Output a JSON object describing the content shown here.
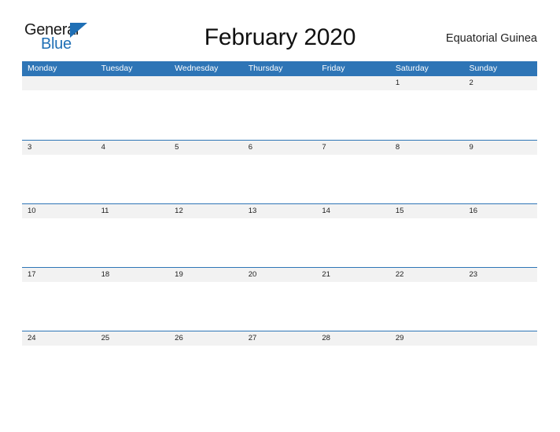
{
  "brand": {
    "name_part1": "General",
    "name_part2": "Blue",
    "flag_icon": "triangle-flag-icon",
    "accent_color": "#1f6fb5"
  },
  "header": {
    "title": "February 2020",
    "country": "Equatorial Guinea"
  },
  "theme": {
    "header_blue": "#2e75b6",
    "band_gray": "#f2f2f2",
    "text_dark": "#1c1c1c",
    "page_background": "#ffffff"
  },
  "calendar": {
    "month": "February",
    "year": "2020",
    "weekdays": [
      "Monday",
      "Tuesday",
      "Wednesday",
      "Thursday",
      "Friday",
      "Saturday",
      "Sunday"
    ],
    "weeks": [
      [
        "",
        "",
        "",
        "",
        "",
        "1",
        "2"
      ],
      [
        "3",
        "4",
        "5",
        "6",
        "7",
        "8",
        "9"
      ],
      [
        "10",
        "11",
        "12",
        "13",
        "14",
        "15",
        "16"
      ],
      [
        "17",
        "18",
        "19",
        "20",
        "21",
        "22",
        "23"
      ],
      [
        "24",
        "25",
        "26",
        "27",
        "28",
        "29",
        ""
      ]
    ]
  }
}
